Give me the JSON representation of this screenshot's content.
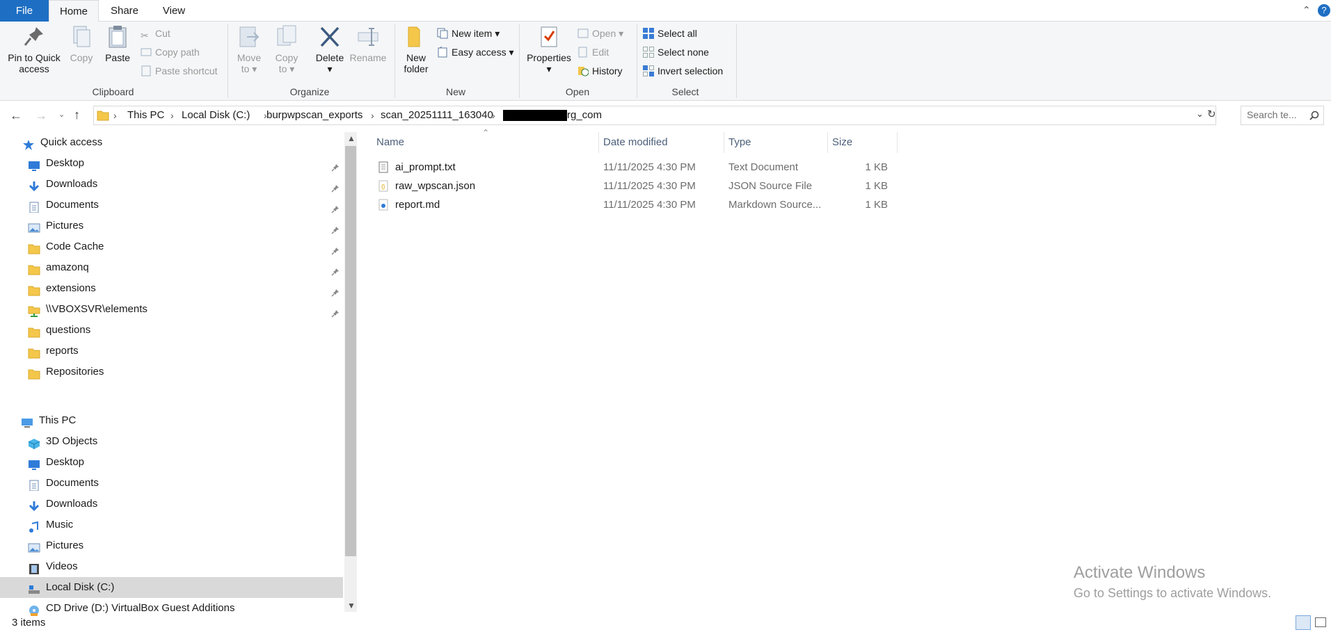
{
  "ribbon_tabs": {
    "file": "File",
    "home": "Home",
    "share": "Share",
    "view": "View"
  },
  "clipboard": {
    "pin_label_1": "Pin to Quick",
    "pin_label_2": "access",
    "copy": "Copy",
    "paste": "Paste",
    "cut": "Cut",
    "copy_path": "Copy path",
    "paste_shortcut": "Paste shortcut",
    "group": "Clipboard"
  },
  "organize": {
    "move_to_1": "Move",
    "move_to_2": "to",
    "copy_to_1": "Copy",
    "copy_to_2": "to",
    "delete": "Delete",
    "rename": "Rename",
    "group": "Organize"
  },
  "new_group": {
    "new_folder_1": "New",
    "new_folder_2": "folder",
    "new_item": "New item",
    "easy_access": "Easy access",
    "group": "New"
  },
  "open_group": {
    "properties": "Properties",
    "open": "Open",
    "edit": "Edit",
    "history": "History",
    "group": "Open"
  },
  "select_group": {
    "select_all": "Select all",
    "select_none": "Select none",
    "invert": "Invert selection",
    "group": "Select"
  },
  "breadcrumb": [
    "This PC",
    "Local Disk (C:)",
    "burpwpscan_exports",
    "scan_20251111_163040",
    "rg_com"
  ],
  "search": {
    "placeholder": "Search te..."
  },
  "nav": {
    "quick_access": "Quick access",
    "quick_items": [
      {
        "label": "Desktop",
        "icon": "desktop-icon",
        "pinned": true
      },
      {
        "label": "Downloads",
        "icon": "downloads-icon",
        "pinned": true
      },
      {
        "label": "Documents",
        "icon": "documents-icon",
        "pinned": true
      },
      {
        "label": "Pictures",
        "icon": "pictures-icon",
        "pinned": true
      },
      {
        "label": "Code Cache",
        "icon": "folder-icon",
        "pinned": true
      },
      {
        "label": "amazonq",
        "icon": "folder-icon",
        "pinned": true
      },
      {
        "label": "extensions",
        "icon": "folder-icon",
        "pinned": true
      },
      {
        "label": "\\\\VBOXSVR\\elements",
        "icon": "network-folder-icon",
        "pinned": true
      },
      {
        "label": "questions",
        "icon": "folder-icon",
        "pinned": false
      },
      {
        "label": "reports",
        "icon": "folder-icon",
        "pinned": false
      },
      {
        "label": "Repositories",
        "icon": "folder-icon",
        "pinned": false
      }
    ],
    "this_pc": "This PC",
    "pc_items": [
      {
        "label": "3D Objects",
        "icon": "3d-objects-icon"
      },
      {
        "label": "Desktop",
        "icon": "desktop-icon"
      },
      {
        "label": "Documents",
        "icon": "documents-icon"
      },
      {
        "label": "Downloads",
        "icon": "downloads-icon"
      },
      {
        "label": "Music",
        "icon": "music-icon"
      },
      {
        "label": "Pictures",
        "icon": "pictures-icon"
      },
      {
        "label": "Videos",
        "icon": "videos-icon"
      },
      {
        "label": "Local Disk (C:)",
        "icon": "drive-icon",
        "selected": true
      },
      {
        "label": "CD Drive (D:) VirtualBox Guest Additions",
        "icon": "cd-drive-icon"
      }
    ]
  },
  "columns": {
    "name": "Name",
    "date": "Date modified",
    "type": "Type",
    "size": "Size"
  },
  "files": [
    {
      "name": "ai_prompt.txt",
      "date": "11/11/2025 4:30 PM",
      "type": "Text Document",
      "size": "1 KB",
      "icon": "text-file-icon"
    },
    {
      "name": "raw_wpscan.json",
      "date": "11/11/2025 4:30 PM",
      "type": "JSON Source File",
      "size": "1 KB",
      "icon": "json-file-icon"
    },
    {
      "name": "report.md",
      "date": "11/11/2025 4:30 PM",
      "type": "Markdown Source...",
      "size": "1 KB",
      "icon": "markdown-file-icon"
    }
  ],
  "watermark": {
    "line1": "Activate Windows",
    "line2": "Go to Settings to activate Windows."
  },
  "status": {
    "items": "3 items"
  },
  "colors": {
    "accent": "#1e6fc4",
    "folder": "#f4c74b",
    "selected": "#d9d9d9"
  }
}
